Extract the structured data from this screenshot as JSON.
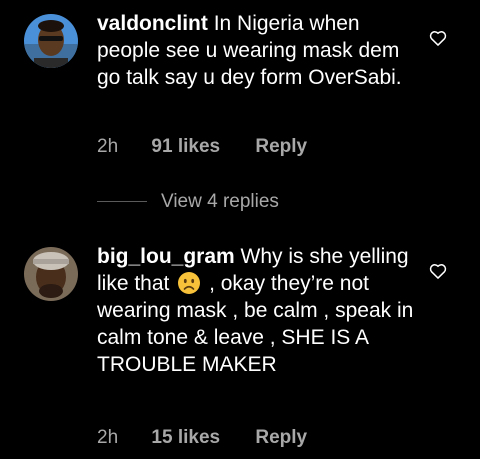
{
  "comments": [
    {
      "username": "valdonclint",
      "text": "In Nigeria when people see u wearing mask dem go talk say u dey form OverSabi.",
      "time": "2h",
      "likes": "91 likes",
      "reply_label": "Reply"
    },
    {
      "username": "big_lou_gram",
      "text_before_emoji": "Why is she yelling like that",
      "emoji": "worried-face",
      "text_after_emoji": ", okay they’re not wearing mask , be calm , speak in calm tone & leave , SHE IS A TROUBLE MAKER",
      "time": "2h",
      "likes": "15 likes",
      "reply_label": "Reply"
    }
  ],
  "view_replies_label": "View 4 replies",
  "icons": {
    "like": "heart-outline-icon"
  },
  "colors": {
    "background": "#000000",
    "text": "#ffffff",
    "meta": "#a8a8a8"
  }
}
